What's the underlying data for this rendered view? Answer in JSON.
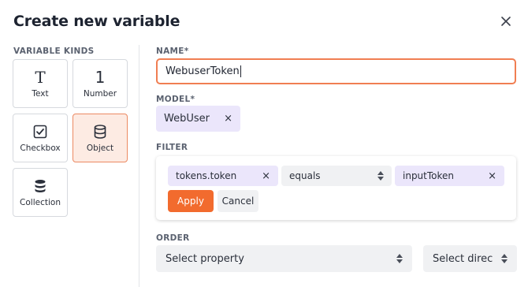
{
  "dialog": {
    "title": "Create new variable"
  },
  "left": {
    "section_label": "VARIABLE KINDS",
    "kinds": [
      {
        "label": "Text",
        "icon": "text-icon",
        "glyph": "T"
      },
      {
        "label": "Number",
        "icon": "number-icon",
        "glyph": "1"
      },
      {
        "label": "Checkbox",
        "icon": "checkbox-icon"
      },
      {
        "label": "Object",
        "icon": "database-icon",
        "selected": true
      },
      {
        "label": "Collection",
        "icon": "collection-icon"
      }
    ]
  },
  "form": {
    "name_label": "NAME*",
    "name_value": "WebuserToken",
    "model_label": "MODEL*",
    "model_chip": {
      "label": "WebUser",
      "remove": "×"
    },
    "filter_label": "FILTER",
    "filter": {
      "property_chip": {
        "label": "tokens.token",
        "remove": "×"
      },
      "operator": "equals",
      "value_chip": {
        "label": "inputToken",
        "remove": "×"
      },
      "apply_label": "Apply",
      "cancel_label": "Cancel"
    },
    "order_label": "ORDER",
    "order_property_placeholder": "Select property",
    "order_direction_placeholder": "Select direc"
  },
  "colors": {
    "accent": "#f26b2e",
    "selected_bg": "#fdebe3",
    "chip_bg": "#ebe6fb",
    "field_bg": "#f0f1f3"
  }
}
